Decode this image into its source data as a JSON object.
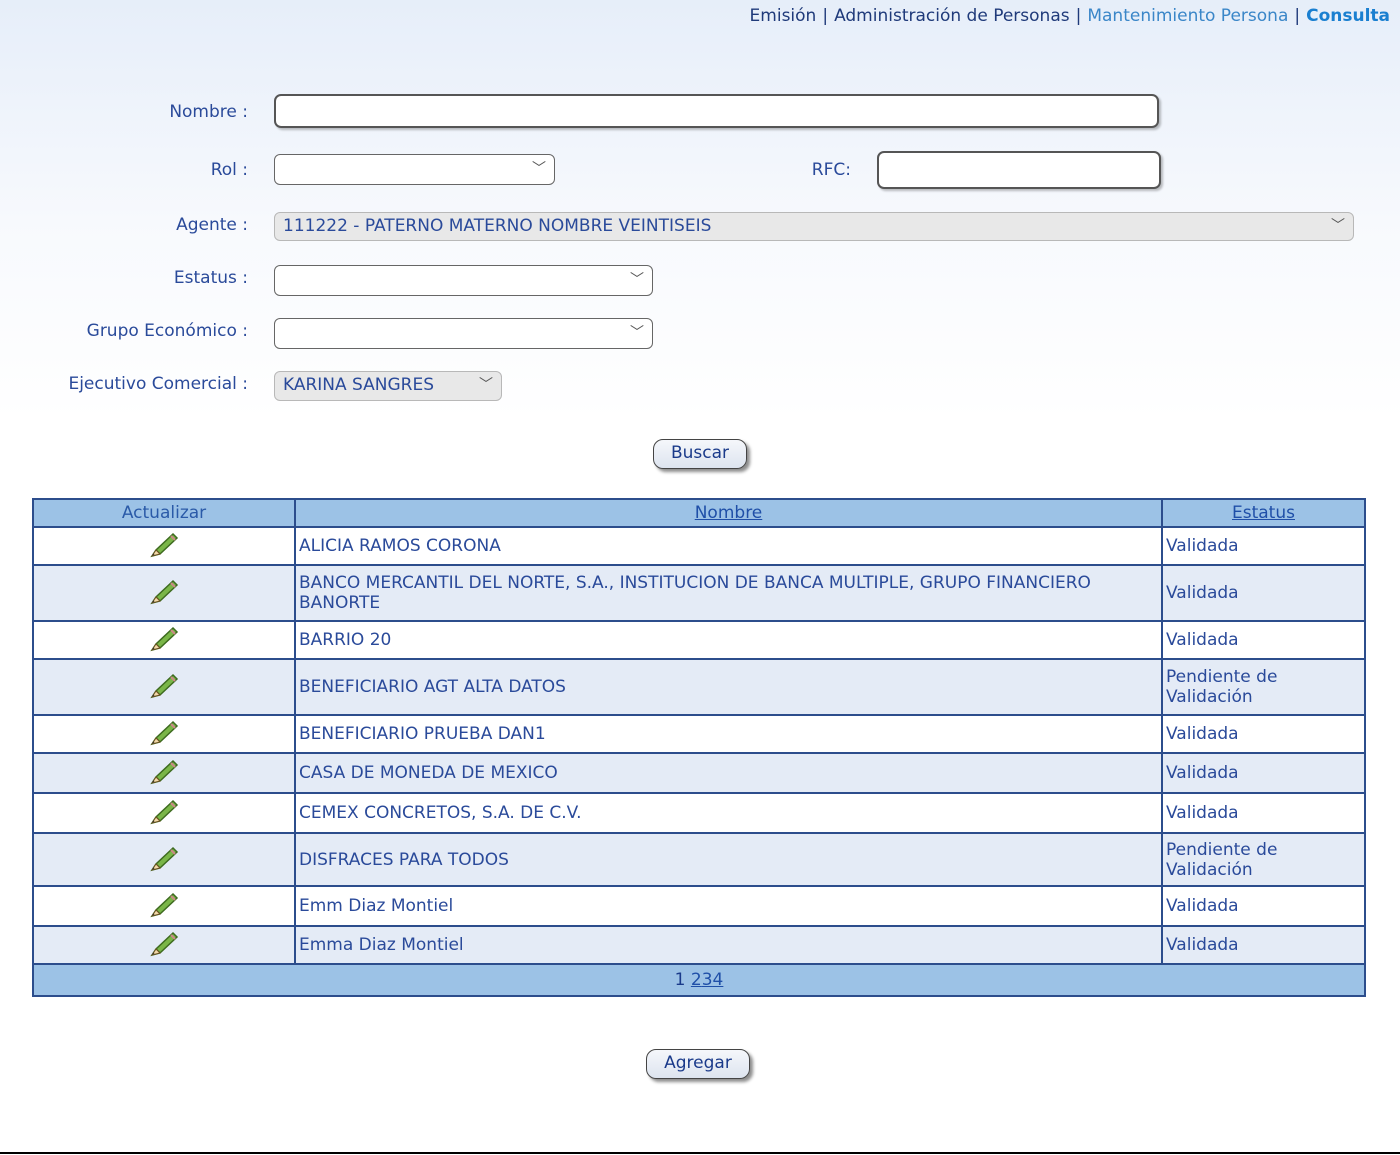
{
  "breadcrumb": {
    "items": [
      "Emisión",
      "Administración de Personas",
      "Mantenimiento Persona",
      "Consulta"
    ],
    "separator": "|"
  },
  "form": {
    "nombre_label": "Nombre :",
    "nombre_value": "",
    "rol_label": "Rol :",
    "rol_value": "",
    "rfc_label": "RFC:",
    "rfc_value": "",
    "agente_label": "Agente :",
    "agente_value": "111222 - PATERNO MATERNO NOMBRE VEINTISEIS",
    "estatus_label": "Estatus :",
    "estatus_value": "",
    "grupo_label": "Grupo Económico :",
    "grupo_value": "",
    "ejecutivo_label": "Ejecutivo Comercial :",
    "ejecutivo_value": "KARINA SANGRES"
  },
  "buttons": {
    "buscar": "Buscar",
    "agregar": "Agregar"
  },
  "table": {
    "headers": {
      "actualizar": "Actualizar",
      "nombre": "Nombre",
      "estatus": "Estatus"
    },
    "rows": [
      {
        "nombre": "ALICIA RAMOS CORONA",
        "estatus": "Validada"
      },
      {
        "nombre": "BANCO MERCANTIL DEL NORTE, S.A., INSTITUCION DE BANCA MULTIPLE, GRUPO FINANCIERO BANORTE",
        "estatus": "Validada"
      },
      {
        "nombre": "BARRIO 20",
        "estatus": "Validada"
      },
      {
        "nombre": "BENEFICIARIO AGT ALTA DATOS",
        "estatus": "Pendiente de Validación"
      },
      {
        "nombre": "BENEFICIARIO PRUEBA DAN1",
        "estatus": "Validada"
      },
      {
        "nombre": "CASA DE MONEDA DE MEXICO",
        "estatus": "Validada"
      },
      {
        "nombre": "CEMEX CONCRETOS, S.A. DE C.V.",
        "estatus": "Validada"
      },
      {
        "nombre": "DISFRACES PARA TODOS",
        "estatus": "Pendiente de Validación"
      },
      {
        "nombre": "Emm Diaz Montiel",
        "estatus": "Validada"
      },
      {
        "nombre": "Emma Diaz Montiel",
        "estatus": "Validada"
      }
    ],
    "pager": {
      "current": "1",
      "pages": [
        "2",
        "3",
        "4"
      ]
    }
  },
  "icons": {
    "edit": "pencil-icon",
    "dropdown": "chevron-down-icon"
  }
}
